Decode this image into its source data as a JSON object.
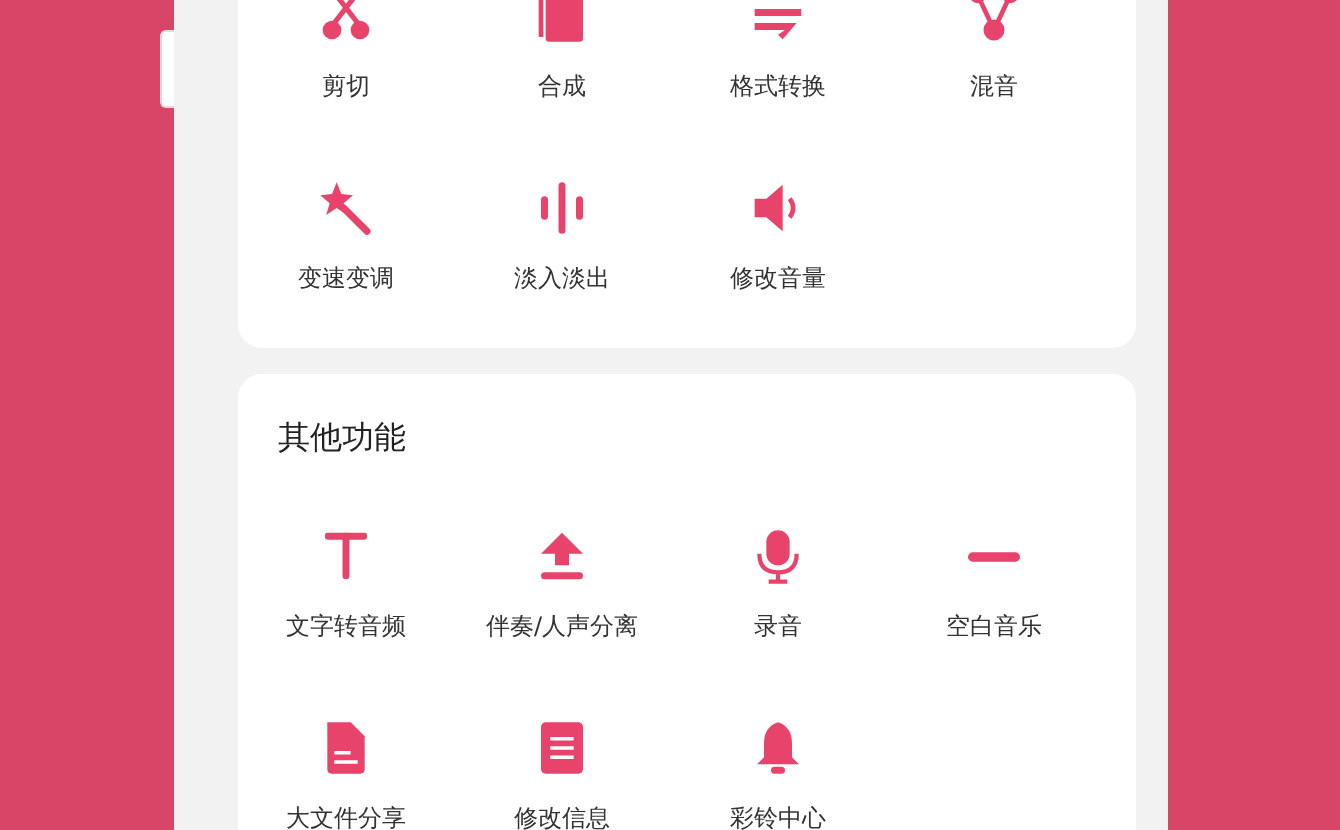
{
  "sections": [
    {
      "items": [
        {
          "label": "剪切"
        },
        {
          "label": "合成"
        },
        {
          "label": "格式转换"
        },
        {
          "label": "混音"
        },
        {
          "label": "变速变调"
        },
        {
          "label": "淡入淡出"
        },
        {
          "label": "修改音量"
        }
      ]
    },
    {
      "title": "其他功能",
      "items": [
        {
          "label": "文字转音频"
        },
        {
          "label": "伴奏/人声分离"
        },
        {
          "label": "录音"
        },
        {
          "label": "空白音乐"
        },
        {
          "label": "大文件分享"
        },
        {
          "label": "修改信息"
        },
        {
          "label": "彩铃中心"
        }
      ]
    }
  ]
}
